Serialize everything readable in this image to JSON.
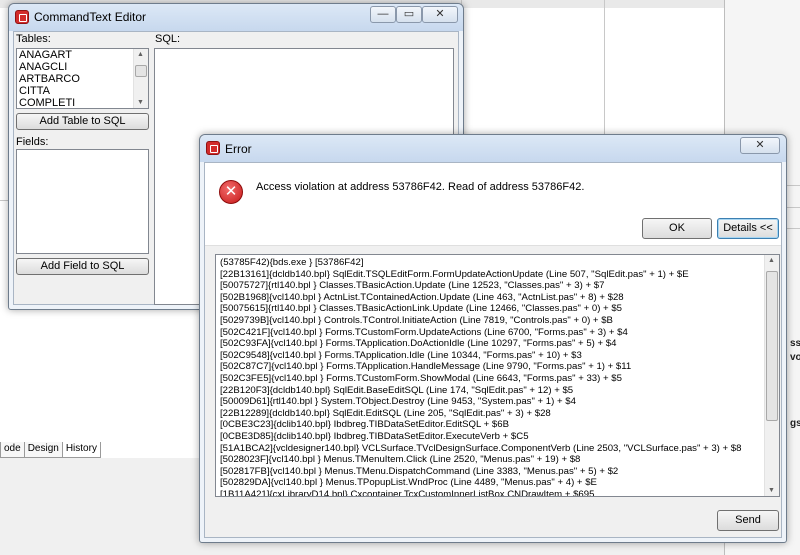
{
  "background": {
    "tabs": [
      "ode",
      "Design",
      "History"
    ],
    "right_texts": [
      "ss",
      "vo",
      "gs"
    ]
  },
  "commandtext_editor": {
    "title": "CommandText Editor",
    "title_buttons": {
      "minimize": "—",
      "maximize": "▭",
      "close": "✕"
    },
    "tables_label": "Tables:",
    "tables": [
      "ANAGART",
      "ANAGCLI",
      "ARTBARCO",
      "CITTA",
      "COMPLETI"
    ],
    "sql_label": "SQL:",
    "add_table_button": "Add Table to SQL",
    "fields_label": "Fields:",
    "add_field_button": "Add Field to SQL"
  },
  "error_dialog": {
    "title": "Error",
    "close_label": "✕",
    "message": "Access violation at address 53786F42. Read of address 53786F42.",
    "ok_button": "OK",
    "details_button": "Details <<",
    "send_button": "Send",
    "details_lines": [
      "(53785F42){bds.exe    } [53786F42]",
      "[22B13161]{dcldb140.bpl} SqlEdit.TSQLEditForm.FormUpdateActionUpdate (Line 507, \"SqlEdit.pas\" + 1) + $E",
      "[50075727]{rtl140.bpl  } Classes.TBasicAction.Update (Line 12523, \"Classes.pas\" + 3) + $7",
      "[502B1968]{vcl140.bpl  } ActnList.TContainedAction.Update (Line 463, \"ActnList.pas\" + 8) + $28",
      "[50075615]{rtl140.bpl  } Classes.TBasicActionLink.Update (Line 12466, \"Classes.pas\" + 0) + $5",
      "[5029739B]{vcl140.bpl  } Controls.TControl.InitiateAction (Line 7819, \"Controls.pas\" + 0) + $B",
      "[502C421F]{vcl140.bpl  } Forms.TCustomForm.UpdateActions (Line 6700, \"Forms.pas\" + 3) + $4",
      "[502C93FA]{vcl140.bpl  } Forms.TApplication.DoActionIdle (Line 10297, \"Forms.pas\" + 5) + $4",
      "[502C9548]{vcl140.bpl  } Forms.TApplication.Idle (Line 10344, \"Forms.pas\" + 10) + $3",
      "[502C87C7]{vcl140.bpl  } Forms.TApplication.HandleMessage (Line 9790, \"Forms.pas\" + 1) + $11",
      "[502C3FE5]{vcl140.bpl  } Forms.TCustomForm.ShowModal (Line 6643, \"Forms.pas\" + 33) + $5",
      "[22B120F3]{dcldb140.bpl} SqlEdit.BaseEditSQL (Line 174, \"SqlEdit.pas\" + 12) + $5",
      "[50009D61]{rtl140.bpl  } System.TObject.Destroy (Line 9453, \"System.pas\" + 1) + $4",
      "[22B12289]{dcldb140.bpl} SqlEdit.EditSQL (Line 205, \"SqlEdit.pas\" + 3) + $28",
      "[0CBE3C23]{dclib140.bpl} Ibdbreg.TIBDataSetEditor.EditSQL + $6B",
      "[0CBE3D85]{dclib140.bpl} Ibdbreg.TIBDataSetEditor.ExecuteVerb + $C5",
      "[51A1BCA2]{vcldesigner140.bpl} VCLSurface.TVclDesignSurface.ComponentVerb (Line 2503, \"VCLSurface.pas\" + 3) + $8",
      "[5028023F]{vcl140.bpl  } Menus.TMenuItem.Click (Line 2520, \"Menus.pas\" + 19) + $8",
      "[502817FB]{vcl140.bpl  } Menus.TMenu.DispatchCommand (Line 3383, \"Menus.pas\" + 5) + $2",
      "[502829DA]{vcl140.bpl  } Menus.TPopupList.WndProc (Line 4489, \"Menus.pas\" + 4) + $E",
      "[1B11A421]{cxLibraryD14.bpl} Cxcontainer.TcxCustomInnerListBox.CNDrawItem + $695"
    ]
  }
}
